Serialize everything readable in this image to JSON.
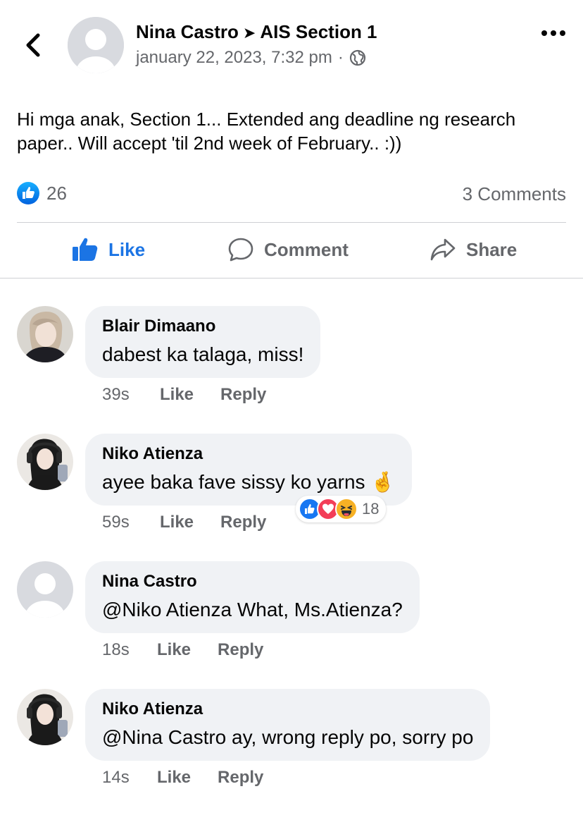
{
  "post": {
    "author": "Nina Castro",
    "arrow": "➤",
    "group": "AIS Section 1",
    "timestamp": "january 22, 2023, 7:32 pm",
    "meta_dot": "·",
    "text": "Hi mga anak, Section 1... Extended ang deadline ng research paper.. Will accept 'til 2nd week of February.. :))",
    "likes": "26",
    "comments_count": "3 Comments"
  },
  "actions": {
    "like": "Like",
    "comment": "Comment",
    "share": "Share"
  },
  "colors": {
    "accent": "#1b74e4",
    "muted": "#65676b",
    "bubble": "#f0f2f5"
  },
  "comments": [
    {
      "name": "Blair Dimaano",
      "text": "dabest ka talaga, miss!",
      "time": "39s",
      "like": "Like",
      "reply": "Reply"
    },
    {
      "name": "Niko Atienza",
      "text": "ayee baka fave sissy ko yarns",
      "emoji": "🤞",
      "time": "59s",
      "like": "Like",
      "reply": "Reply",
      "reactions": "18"
    },
    {
      "name": "Nina Castro",
      "text": "@Niko Atienza What, Ms.Atienza?",
      "time": "18s",
      "like": "Like",
      "reply": "Reply"
    },
    {
      "name": "Niko Atienza",
      "text": "@Nina Castro ay, wrong reply po, sorry po",
      "time": "14s",
      "like": "Like",
      "reply": "Reply"
    }
  ]
}
